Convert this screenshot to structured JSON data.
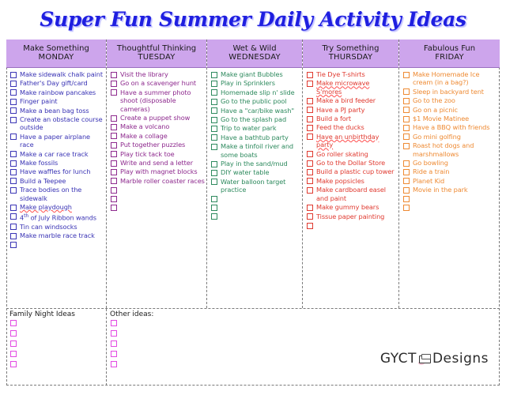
{
  "page": {
    "title": "Super Fun Summer Daily Activity Ideas",
    "title_color": "#1f1fe0",
    "header_band_color": "#cda5ec"
  },
  "columns": [
    {
      "id": "monday",
      "heading_line1": "Make Something",
      "heading_line2": "MONDAY",
      "color": "#3a34b5",
      "items": [
        "Make sidewalk chalk paint",
        "Father's Day gift/card",
        "Make rainbow pancakes",
        "Finger paint",
        "Make a bean bag toss",
        "Create an obstacle course outside",
        "Have a paper airplane race",
        "Make a car race track",
        "Make fossils",
        "Have waffles for lunch",
        "Build a Teepee",
        "Trace bodies on the sidewalk",
        "Make playdough",
        "4th of July Ribbon wands",
        "Tin can windsocks",
        " Make marble race track"
      ],
      "blank_items": 1
    },
    {
      "id": "tuesday",
      "heading_line1": "Thoughtful Thinking",
      "heading_line2": "TUESDAY",
      "color": "#8e2a8e",
      "items": [
        "Visit the library",
        "Go on a scavenger hunt",
        "Have a summer photo shoot (disposable cameras)",
        "Create a puppet show",
        "Make a volcano",
        "Make a collage",
        "Put together puzzles",
        "Play tick tack toe",
        "Write and send a letter",
        "Play with magnet blocks",
        "Marble roller coaster races"
      ],
      "blank_items": 3
    },
    {
      "id": "wednesday",
      "heading_line1": "Wet & Wild",
      "heading_line2": "WEDNESDAY",
      "color": "#2e8a5e",
      "items": [
        "Make giant Bubbles",
        "Play in Sprinklers",
        "Homemade slip n' slide",
        "Go to the public pool",
        "Have a \"car/bike wash\"",
        "Go to the splash pad",
        "Trip to water park",
        "Have a bathtub party",
        "Make a tinfoil river and some boats",
        "Play in the sand/mud",
        "DIY water table",
        "Water balloon target practice"
      ],
      "blank_items": 3
    },
    {
      "id": "thursday",
      "heading_line1": "Try Something",
      "heading_line2": "THURSDAY",
      "color": "#e03a30",
      "items": [
        "Tie Dye T-shirts",
        "Make microwave S'mores",
        "Make a bird feeder",
        "Have a PJ party",
        "Build a fort",
        "Feed the ducks",
        "Have an unbirthday party",
        "Go roller skating",
        "Go to the Dollar Store",
        "Build a plastic cup tower",
        "Make popsicles",
        "Make cardboard easel and paint",
        "Make gummy bears",
        " Tissue paper painting"
      ],
      "blank_items": 1
    },
    {
      "id": "friday",
      "heading_line1": "Fabulous Fun",
      "heading_line2": "FRIDAY",
      "color": "#ee8a33",
      "items": [
        "Make Homemade Ice cream (in a bag?)",
        "Sleep in backyard tent",
        "Go to the zoo",
        "Go on a picnic",
        "$1 Movie Matinee",
        "Have a BBQ with friends",
        "Go mini golfing",
        "Roast hot dogs and marshmallows",
        "Go bowling",
        "Ride a train",
        "Planet Kid",
        "Movie in the park"
      ],
      "blank_items": 2
    }
  ],
  "notes": {
    "family_night_title": "Family Night Ideas",
    "family_night_boxes": 5,
    "other_ideas_title": "Other ideas:",
    "other_ideas_boxes": 5,
    "checkbox_color": "#e24ae2"
  },
  "logo": {
    "text_left": "GYCT",
    "text_right": "Designs",
    "icon": "books-stack-icon"
  }
}
